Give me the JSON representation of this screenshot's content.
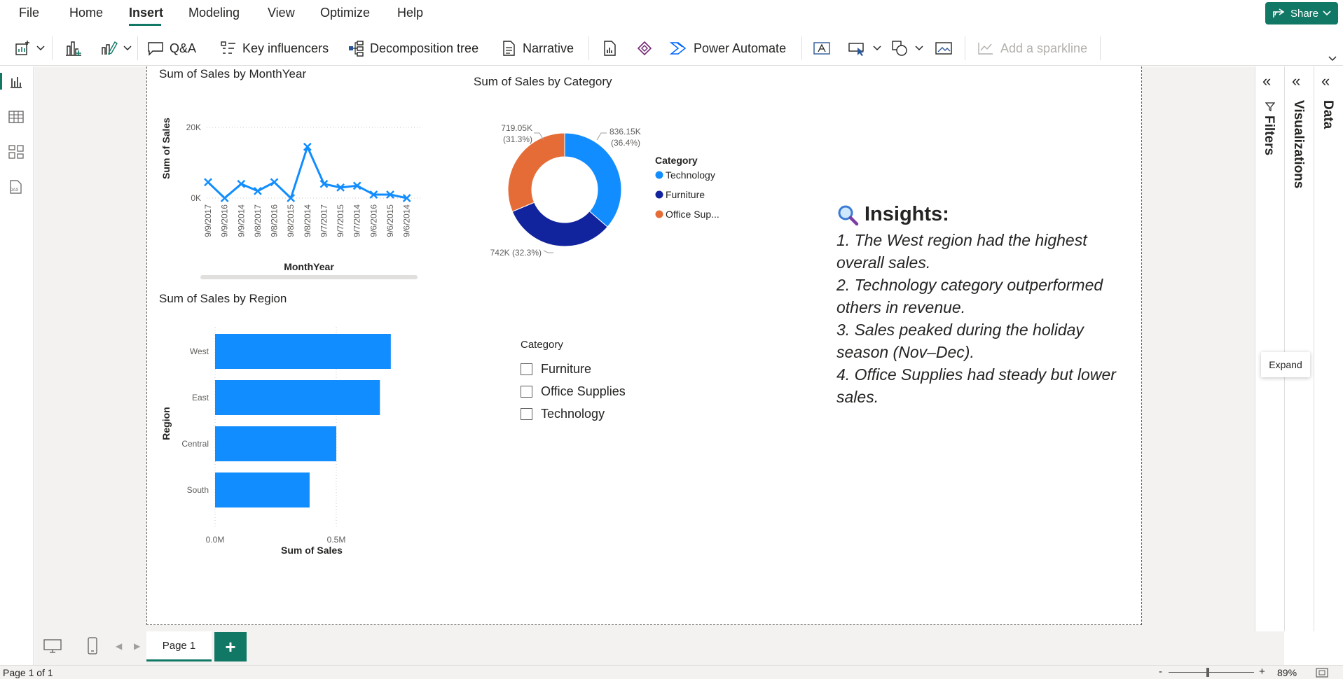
{
  "menu": {
    "items": [
      "File",
      "Home",
      "Insert",
      "Modeling",
      "View",
      "Optimize",
      "Help"
    ],
    "share": "Share"
  },
  "ribbon": {
    "qa": "Q&A",
    "key_influencers": "Key influencers",
    "decomposition_tree": "Decomposition tree",
    "narrative": "Narrative",
    "power_automate": "Power Automate",
    "add_sparkline": "Add a sparkline"
  },
  "line_chart": {
    "title": "Sum of Sales by MonthYear",
    "ylabel": "Sum of Sales",
    "xlabel": "MonthYear",
    "yticks": [
      "20K",
      "0K"
    ]
  },
  "donut_chart": {
    "title": "Sum of Sales by Category",
    "legend_title": "Category",
    "labels": {
      "office": "719.05K\n(31.3%)",
      "office_l1": "719.05K",
      "office_l2": "(31.3%)",
      "tech_l1": "836.15K",
      "tech_l2": "(36.4%)",
      "furn": "742K (32.3%)"
    }
  },
  "bar_chart": {
    "title": "Sum of Sales by Region",
    "ylabel": "Region",
    "xlabel": "Sum of Sales",
    "xticks": [
      "0.0M",
      "0.5M"
    ]
  },
  "chart_data": [
    {
      "type": "line",
      "title": "Sum of Sales by MonthYear",
      "xlabel": "MonthYear",
      "ylabel": "Sum of Sales",
      "x": [
        "9/9/2017",
        "9/9/2016",
        "9/9/2014",
        "9/8/2017",
        "9/8/2016",
        "9/8/2015",
        "9/8/2014",
        "9/7/2017",
        "9/7/2015",
        "9/7/2014",
        "9/6/2016",
        "9/6/2015",
        "9/6/2014"
      ],
      "series": [
        {
          "values": [
            4500,
            0,
            4000,
            2000,
            4500,
            0,
            14500,
            4000,
            3000,
            3500,
            1000,
            1000,
            0
          ]
        }
      ],
      "ylim": [
        0,
        20000
      ],
      "color": "#118DFF",
      "grid": true
    },
    {
      "type": "pie",
      "title": "Sum of Sales by Category",
      "categories": [
        "Technology",
        "Furniture",
        "Office Supplies"
      ],
      "values": [
        836150,
        742000,
        719050
      ],
      "percents": [
        36.4,
        32.3,
        31.3
      ],
      "colors": [
        "#118DFF",
        "#12239E",
        "#E66C37"
      ],
      "legend_title": "Category",
      "legend_labels": [
        "Technology",
        "Furniture",
        "Office Sup..."
      ],
      "donut": true
    },
    {
      "type": "bar",
      "orientation": "horizontal",
      "title": "Sum of Sales by Region",
      "xlabel": "Sum of Sales",
      "ylabel": "Region",
      "categories": [
        "West",
        "East",
        "Central",
        "South"
      ],
      "values": [
        725000,
        680000,
        500000,
        390000
      ],
      "xlim": [
        0,
        900000
      ],
      "color": "#118DFF"
    }
  ],
  "slicer": {
    "title": "Category",
    "items": [
      "Furniture",
      "Office Supplies",
      "Technology"
    ]
  },
  "insights": {
    "title": "Insights:",
    "lines": [
      "1. The West region had the highest",
      "overall sales.",
      "2. Technology category outperformed",
      "others in revenue.",
      "3. Sales peaked during the holiday",
      "season (Nov–Dec).",
      "4. Office Supplies had steady but lower",
      "sales."
    ]
  },
  "panes": {
    "filters": "Filters",
    "visualizations": "Visualizations",
    "data": "Data",
    "tooltip": "Expand"
  },
  "tabs": {
    "page": "Page 1",
    "add": "+"
  },
  "status": {
    "page_info": "Page 1 of 1",
    "zoom": "89%",
    "zoom_level": 0.89
  }
}
